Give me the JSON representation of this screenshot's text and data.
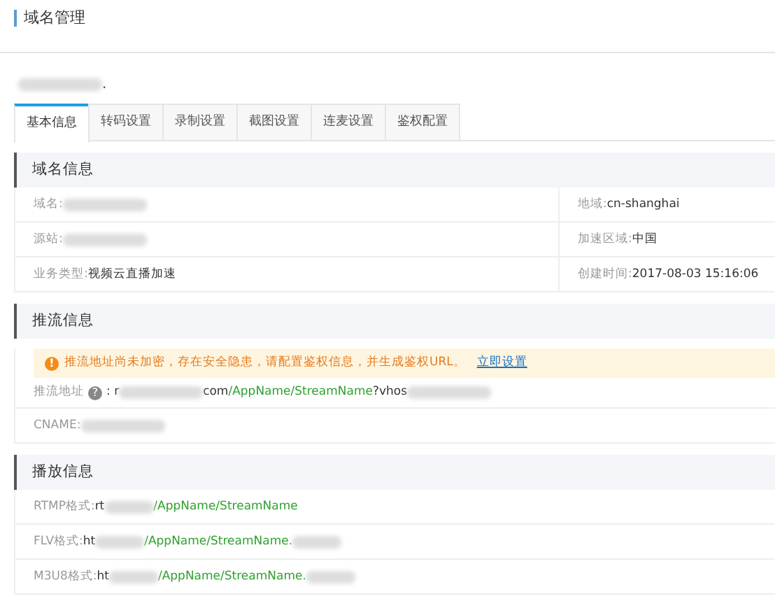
{
  "page_title": "域名管理",
  "domain_heading": [
    {
      "kind": "redacted"
    },
    {
      "kind": "plain",
      "text": "."
    }
  ],
  "tabs": [
    {
      "label": "基本信息",
      "selected": true
    },
    {
      "label": "转码设置",
      "selected": false
    },
    {
      "label": "录制设置",
      "selected": false
    },
    {
      "label": "截图设置",
      "selected": false
    },
    {
      "label": "连麦设置",
      "selected": false
    },
    {
      "label": "鉴权配置",
      "selected": false
    }
  ],
  "domain_info": {
    "title": "域名信息",
    "rows": [
      {
        "left": {
          "label": "域名:",
          "value": [
            {
              "kind": "redacted"
            }
          ]
        },
        "right": {
          "label": "地域:",
          "value": [
            {
              "kind": "plain",
              "text": "cn-shanghai"
            }
          ]
        }
      },
      {
        "left": {
          "label": "源站:",
          "value": [
            {
              "kind": "redacted"
            }
          ]
        },
        "right": {
          "label": "加速区域:",
          "value": [
            {
              "kind": "plain",
              "text": "中国"
            }
          ]
        }
      },
      {
        "left": {
          "label": "业务类型:",
          "value": [
            {
              "kind": "plain",
              "text": "视频云直播加速"
            }
          ]
        },
        "right": {
          "label": "创建时间:",
          "value": [
            {
              "kind": "plain",
              "text": "2017-08-03 15:16:06"
            }
          ]
        }
      }
    ]
  },
  "push_info": {
    "title": "推流信息",
    "alert": {
      "icon": "!",
      "text": "推流地址尚未加密，存在安全隐患，请配置鉴权信息，并生成鉴权URL。",
      "link": "立即设置"
    },
    "address": {
      "label": "推流地址",
      "help": "?",
      "value": [
        {
          "kind": "plain",
          "text": ": r"
        },
        {
          "kind": "redacted"
        },
        {
          "kind": "plain",
          "text": "com"
        },
        {
          "kind": "path",
          "text": "/AppName/StreamName"
        },
        {
          "kind": "plain",
          "text": "?vhos"
        },
        {
          "kind": "redacted"
        }
      ]
    },
    "cname": {
      "label": "CNAME:",
      "value": [
        {
          "kind": "redacted"
        }
      ]
    }
  },
  "play_info": {
    "title": "播放信息",
    "rows": [
      {
        "label": "RTMP格式:",
        "value": [
          {
            "kind": "plain",
            "text": "rt"
          },
          {
            "kind": "redacted"
          },
          {
            "kind": "path",
            "text": "/AppName/StreamName"
          }
        ]
      },
      {
        "label": "FLV格式:",
        "value": [
          {
            "kind": "plain",
            "text": "ht"
          },
          {
            "kind": "redacted"
          },
          {
            "kind": "path",
            "text": "/AppName/StreamName."
          },
          {
            "kind": "redacted"
          }
        ]
      },
      {
        "label": "M3U8格式:",
        "value": [
          {
            "kind": "plain",
            "text": "ht"
          },
          {
            "kind": "redacted"
          },
          {
            "kind": "path",
            "text": "/AppName/StreamName."
          },
          {
            "kind": "redacted"
          }
        ]
      }
    ]
  }
}
